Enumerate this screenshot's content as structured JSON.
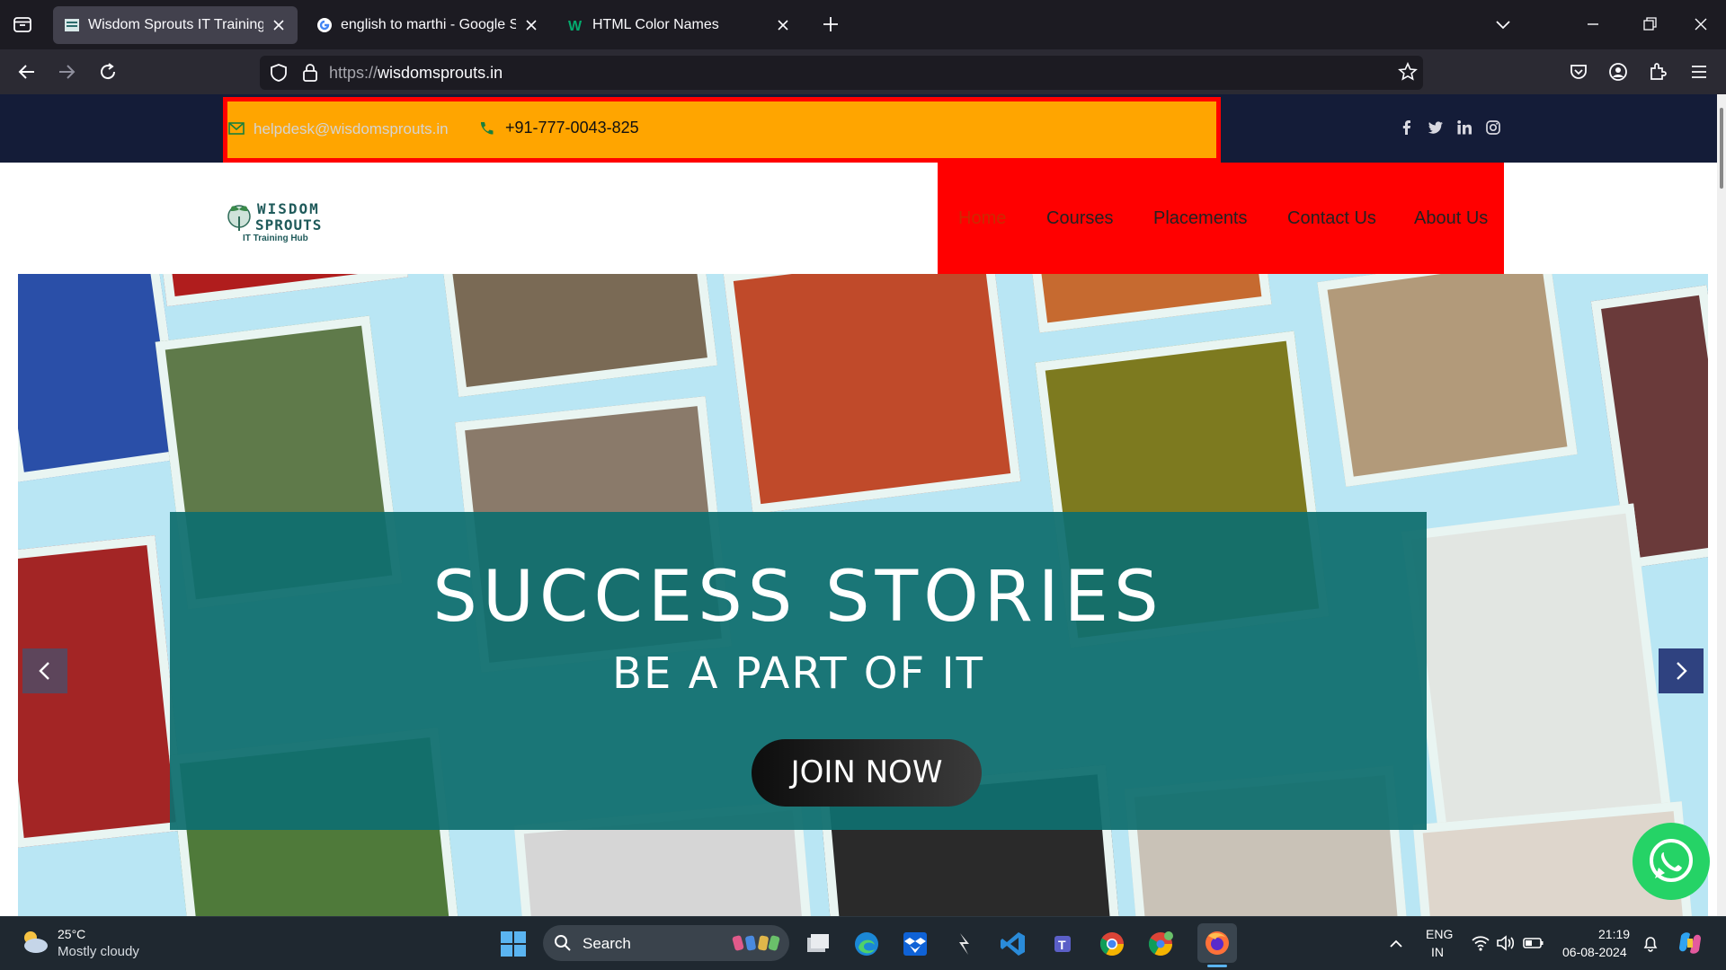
{
  "browser": {
    "tabs": [
      {
        "label": "Wisdom Sprouts IT Training Hub",
        "active": true,
        "icon": "wisdom-favicon"
      },
      {
        "label": "english to marthi - Google Search",
        "active": false,
        "icon": "google-favicon"
      },
      {
        "label": "HTML Color Names",
        "active": false,
        "icon": "w3schools-favicon"
      }
    ],
    "url_protocol": "https://",
    "url_domain": "wisdomsprouts.in"
  },
  "topbar": {
    "email": "helpdesk@wisdomsprouts.in",
    "phone": "+91-777-0043-825",
    "socials": [
      "facebook-icon",
      "twitter-icon",
      "linkedin-icon",
      "instagram-icon"
    ],
    "colors": {
      "bar": "#141c38",
      "highlight": "#ffa500",
      "border": "#ff0000"
    }
  },
  "logo": {
    "line1": "WISDOM",
    "line2": "SPROUTS",
    "tagline": "IT Training Hub"
  },
  "menu": {
    "items": [
      "Home",
      "Courses",
      "Placements",
      "Contact Us",
      "About Us"
    ],
    "active": "Home",
    "background": "#ff0000"
  },
  "hero": {
    "headline": "SUCCESS STORIES",
    "subheadline": "BE A PART OF IT",
    "cta": "JOIN NOW",
    "banner_color": "#106e6e"
  },
  "taskbar": {
    "weather_temp": "25°C",
    "weather_desc": "Mostly cloudy",
    "search_placeholder": "Search",
    "lang_line1": "ENG",
    "lang_line2": "IN",
    "time": "21:19",
    "date": "06-08-2024"
  }
}
